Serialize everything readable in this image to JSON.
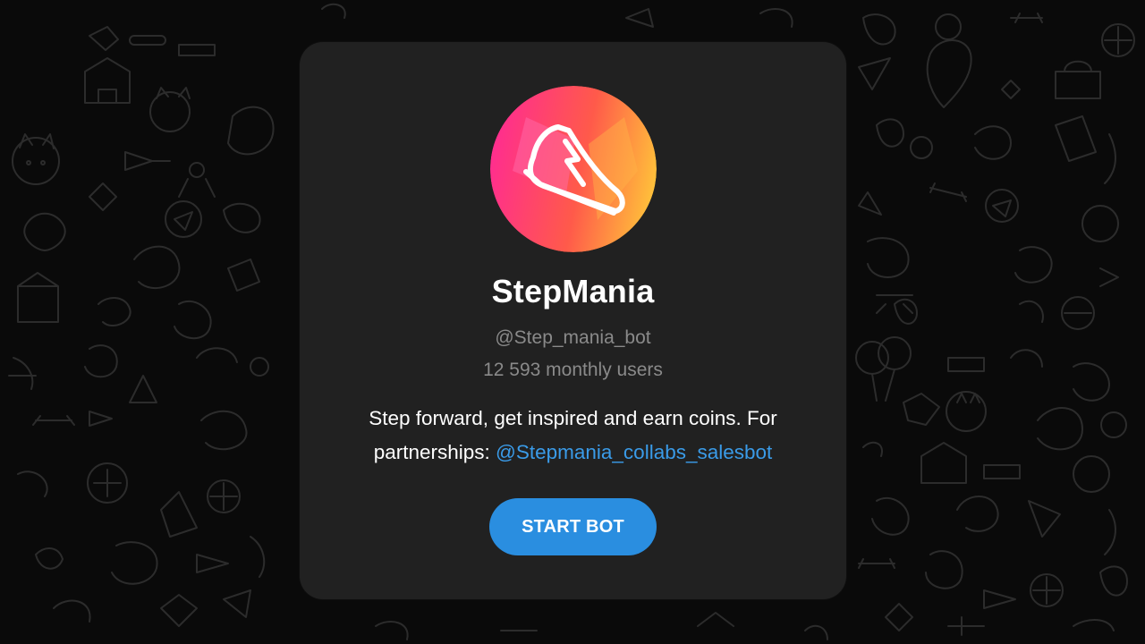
{
  "bot": {
    "name": "StepMania",
    "username": "@Step_mania_bot",
    "monthly_users": "12 593 monthly users",
    "description_text": "Step forward, get inspired and earn coins. For partnerships: ",
    "description_link": "@Stepmania_collabs_salesbot",
    "start_button_label": "START BOT"
  },
  "icons": {
    "avatar": "sneaker-icon",
    "wallpaper": "doodle-pattern"
  },
  "colors": {
    "background": "#0a0a0a",
    "card": "#212121",
    "accent": "#2a8ee0",
    "link": "#3a9be8",
    "muted_text": "#8a8a8a",
    "avatar_gradient": [
      "#ff2d8f",
      "#ff5a4a",
      "#ffc23a"
    ]
  }
}
